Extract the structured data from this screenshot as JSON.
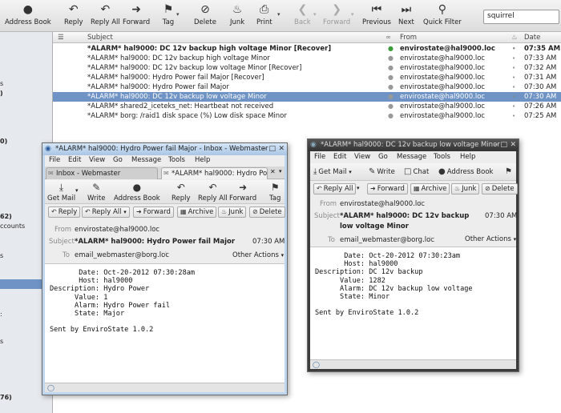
{
  "main_toolbar": {
    "buttons": [
      {
        "label": "Address Book",
        "icon": "person-icon"
      },
      {
        "label": "Reply",
        "icon": "reply-icon"
      },
      {
        "label": "Reply All",
        "icon": "reply-all-icon"
      },
      {
        "label": "Forward",
        "icon": "forward-icon"
      },
      {
        "label": "Tag",
        "icon": "tag-icon"
      },
      {
        "label": "Delete",
        "icon": "delete-icon"
      },
      {
        "label": "Junk",
        "icon": "junk-icon"
      },
      {
        "label": "Print",
        "icon": "print-icon"
      },
      {
        "label": "Back",
        "icon": "back-icon"
      },
      {
        "label": "Forward",
        "icon": "forward-nav-icon"
      },
      {
        "label": "Previous",
        "icon": "previous-icon"
      },
      {
        "label": "Next",
        "icon": "next-icon"
      },
      {
        "label": "Quick Filter",
        "icon": "quick-filter-icon"
      }
    ],
    "search_value": "squirrel"
  },
  "folder_fragments": [
    "s",
    ")",
    "0)",
    "62)",
    "ccounts",
    "s",
    ":",
    "s",
    "76)"
  ],
  "thread_list": {
    "columns": {
      "subject": "Subject",
      "from": "From",
      "date": "Date"
    },
    "rows": [
      {
        "subject": "*ALARM* hal9000: DC 12v backup high voltage Minor [Recover]",
        "from": "envirostate@hal9000.loc",
        "date": "07:35 AM",
        "bold": true,
        "selected": false,
        "unread": true
      },
      {
        "subject": "*ALARM* hal9000: DC 12v backup high voltage Minor",
        "from": "envirostate@hal9000.loc",
        "date": "07:33 AM",
        "bold": false,
        "selected": false,
        "unread": false
      },
      {
        "subject": "*ALARM* hal9000: DC 12v backup low voltage Minor [Recover]",
        "from": "envirostate@hal9000.loc",
        "date": "07:32 AM",
        "bold": false,
        "selected": false,
        "unread": false
      },
      {
        "subject": "*ALARM* hal9000: Hydro Power fail Major [Recover]",
        "from": "envirostate@hal9000.loc",
        "date": "07:31 AM",
        "bold": false,
        "selected": false,
        "unread": false
      },
      {
        "subject": "*ALARM* hal9000: Hydro Power fail Major",
        "from": "envirostate@hal9000.loc",
        "date": "07:30 AM",
        "bold": false,
        "selected": false,
        "unread": false
      },
      {
        "subject": "*ALARM* hal9000: DC 12v backup low voltage Minor",
        "from": "envirostate@hal9000.loc",
        "date": "07:30 AM",
        "bold": false,
        "selected": true,
        "unread": false
      },
      {
        "subject": "*ALARM* shared2_iceteks_net: Heartbeat not received",
        "from": "envirostate@hal9000.loc",
        "date": "07:26 AM",
        "bold": false,
        "selected": false,
        "unread": false
      },
      {
        "subject": "*ALARM* borg: /raid1 disk space (%) Low disk space Minor",
        "from": "envirostate@hal9000.loc",
        "date": "07:25 AM",
        "bold": false,
        "selected": false,
        "unread": false
      }
    ]
  },
  "window1": {
    "title": "*ALARM* hal9000: Hydro Power fail Major - Inbox - Webmaster",
    "menu": [
      "File",
      "Edit",
      "View",
      "Go",
      "Message",
      "Tools",
      "Help"
    ],
    "tabs": [
      "Inbox - Webmaster",
      "*ALARM* hal9000: Hydro Power fail Major"
    ],
    "toolbar": [
      "Get Mail",
      "Write",
      "Address Book",
      "Reply",
      "Reply All",
      "Forward",
      "Tag"
    ],
    "actions": [
      "Reply",
      "Reply All",
      "Forward",
      "Archive",
      "Junk",
      "Delete"
    ],
    "from_label": "From",
    "from": "envirostate@hal9000.loc",
    "subject_label": "Subject",
    "subject": "*ALARM* hal9000: Hydro Power fail Major",
    "time": "07:30 AM",
    "to_label": "To",
    "to": "email_webmaster@borg.loc",
    "other_actions": "Other Actions",
    "body": "       Date: Oct-20-2012 07:30:28am\n       Host: hal9000\nDescription: Hydro Power\n      Value: 1\n      Alarm: Hydro Power fail\n      State: Major\n\nSent by EnviroState 1.0.2"
  },
  "window2": {
    "title": "*ALARM* hal9000: DC 12v backup low voltage Minor",
    "menu": [
      "File",
      "Edit",
      "View",
      "Go",
      "Message",
      "Tools",
      "Help"
    ],
    "toolbar": [
      "Get Mail",
      "Write",
      "Chat",
      "Address Book"
    ],
    "actions": [
      "Reply All",
      "Forward",
      "Archive",
      "Junk",
      "Delete"
    ],
    "from_label": "From",
    "from": "envirostate@hal9000.loc",
    "subject_label": "Subject",
    "subject_line1": "*ALARM* hal9000: DC 12v backup",
    "subject_line2": "low voltage Minor",
    "time": "07:30 AM",
    "to_label": "To",
    "to": "email_webmaster@borg.loc",
    "other_actions": "Other Actions",
    "body": "       Date: Oct-20-2012 07:30:23am\n       Host: hal9000\nDescription: DC 12v backup\n      Value: 1282\n      Alarm: DC 12v backup low voltage\n      State: Minor\n\nSent by EnviroState 1.0.2"
  }
}
